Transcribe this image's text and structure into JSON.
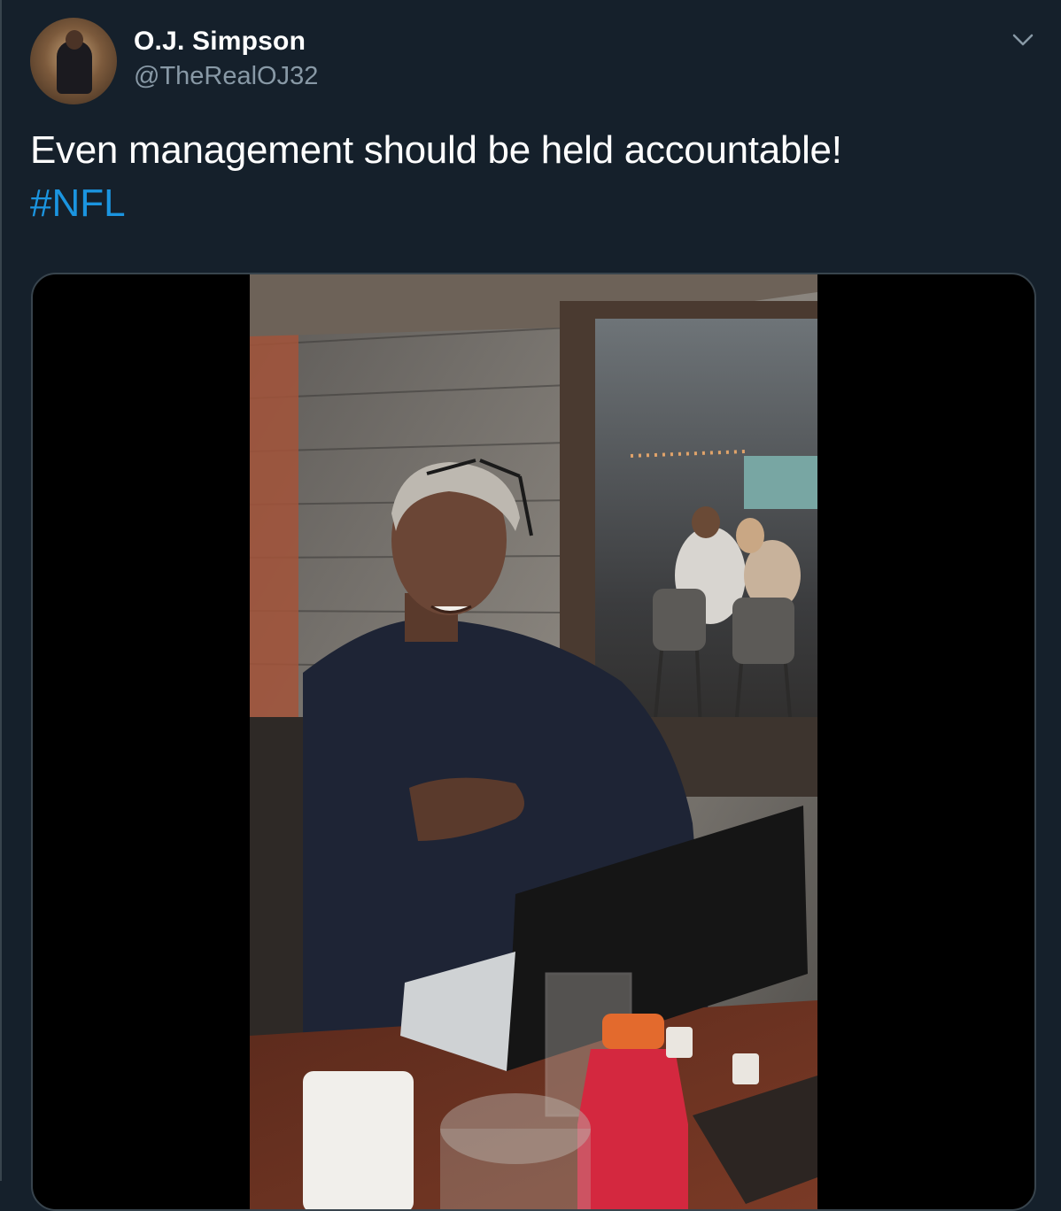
{
  "tweet": {
    "author": {
      "display_name": "O.J. Simpson",
      "handle": "@TheRealOJ32",
      "avatar_icon": "profile-photo"
    },
    "text": "Even management should be held accountable!",
    "hashtag": "#NFL",
    "menu_icon": "chevron-down-icon",
    "colors": {
      "background": "#15202b",
      "text": "#ffffff",
      "secondary_text": "#8899a6",
      "link": "#1b95e0",
      "border": "#38444d"
    }
  },
  "media": {
    "type": "video",
    "description_icon": "video-player"
  }
}
